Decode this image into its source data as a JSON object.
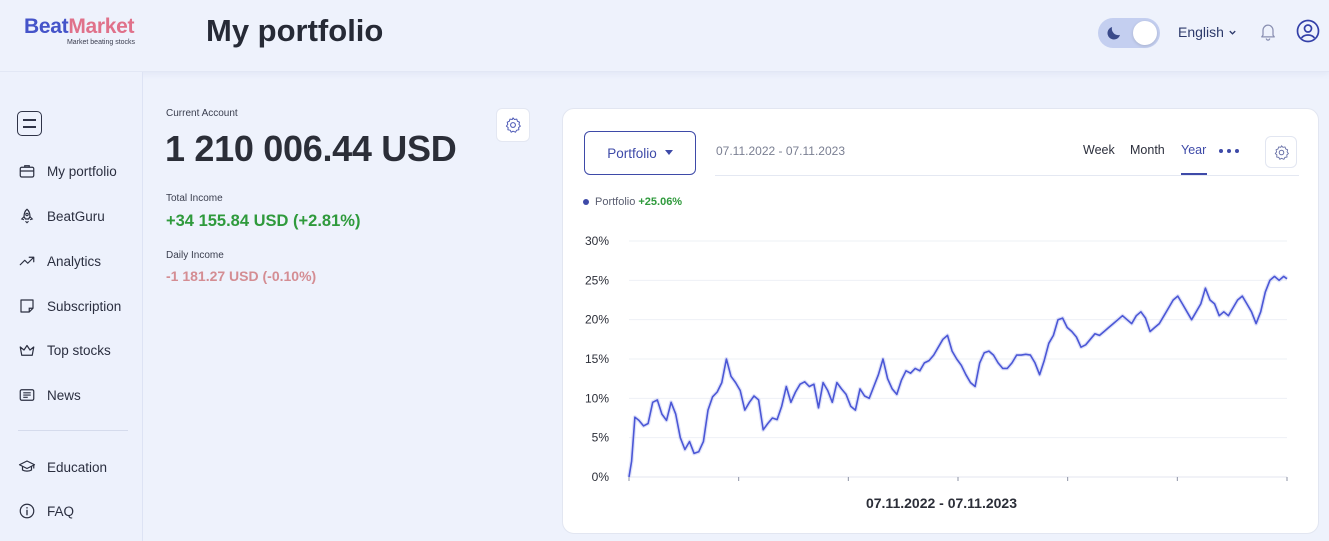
{
  "header": {
    "logo_beat": "Beat",
    "logo_market": "Market",
    "logo_tagline": "Market beating stocks",
    "title": "My portfolio",
    "language": "English"
  },
  "sidebar": {
    "items": [
      {
        "label": "My portfolio",
        "icon": "briefcase-icon"
      },
      {
        "label": "BeatGuru",
        "icon": "rocket-icon"
      },
      {
        "label": "Analytics",
        "icon": "trend-up-icon"
      },
      {
        "label": "Subscription",
        "icon": "sticky-note-icon"
      },
      {
        "label": "Top stocks",
        "icon": "crown-icon"
      },
      {
        "label": "News",
        "icon": "newspaper-icon"
      },
      {
        "label": "Education",
        "icon": "graduation-cap-icon"
      },
      {
        "label": "FAQ",
        "icon": "info-icon"
      }
    ]
  },
  "account": {
    "current_label": "Current Account",
    "current_value": "1 210 006.44 USD",
    "total_income_label": "Total Income",
    "total_income_value": "+34 155.84 USD (+2.81%)",
    "daily_income_label": "Daily Income",
    "daily_income_value": "-1 181.27 USD (-0.10%)"
  },
  "chart_panel": {
    "selector_label": "Portfolio",
    "date_range": "07.11.2022 - 07.11.2023",
    "periods": [
      "Week",
      "Month",
      "Year"
    ],
    "active_period": "Year",
    "legend_label": "Portfolio",
    "legend_value": "+25.06%"
  },
  "colors": {
    "accent": "#3e4aa8",
    "line": "#4b57d6",
    "positive": "#2f9a3c",
    "negative": "#d48d93"
  },
  "chart_data": {
    "type": "line",
    "xlabel": "07.11.2022 - 07.11.2023",
    "ylabel": "",
    "ylim": [
      0,
      30
    ],
    "yticks": [
      "0%",
      "5%",
      "10%",
      "15%",
      "20%",
      "25%",
      "30%"
    ],
    "grid": true,
    "legend": "top-left",
    "series": [
      {
        "name": "Portfolio",
        "x": [
          0,
          0.004,
          0.009,
          0.015,
          0.022,
          0.029,
          0.036,
          0.043,
          0.05,
          0.057,
          0.064,
          0.071,
          0.078,
          0.085,
          0.092,
          0.099,
          0.106,
          0.113,
          0.12,
          0.127,
          0.134,
          0.141,
          0.148,
          0.155,
          0.162,
          0.169,
          0.176,
          0.183,
          0.19,
          0.197,
          0.204,
          0.211,
          0.218,
          0.225,
          0.232,
          0.239,
          0.246,
          0.253,
          0.26,
          0.267,
          0.274,
          0.281,
          0.288,
          0.295,
          0.302,
          0.309,
          0.316,
          0.323,
          0.33,
          0.337,
          0.344,
          0.351,
          0.358,
          0.365,
          0.372,
          0.379,
          0.386,
          0.393,
          0.4,
          0.407,
          0.414,
          0.421,
          0.428,
          0.435,
          0.442,
          0.449,
          0.456,
          0.463,
          0.47,
          0.477,
          0.484,
          0.491,
          0.498,
          0.505,
          0.512,
          0.519,
          0.526,
          0.533,
          0.54,
          0.547,
          0.554,
          0.561,
          0.568,
          0.575,
          0.582,
          0.589,
          0.596,
          0.603,
          0.61,
          0.617,
          0.624,
          0.631,
          0.638,
          0.645,
          0.652,
          0.659,
          0.666,
          0.673,
          0.68,
          0.687,
          0.694,
          0.701,
          0.708,
          0.715,
          0.722,
          0.729,
          0.736,
          0.743,
          0.75,
          0.757,
          0.764,
          0.771,
          0.778,
          0.785,
          0.792,
          0.799,
          0.806,
          0.813,
          0.82,
          0.827,
          0.834,
          0.841,
          0.848,
          0.855,
          0.862,
          0.869,
          0.876,
          0.883,
          0.89,
          0.897,
          0.904,
          0.911,
          0.918,
          0.925,
          0.932,
          0.939,
          0.946,
          0.953,
          0.96,
          0.967,
          0.974,
          0.981,
          0.988,
          0.995,
          1.0
        ],
        "values": [
          0,
          2,
          7.6,
          7.2,
          6.5,
          6.8,
          9.5,
          9.8,
          8.0,
          7.2,
          9.5,
          8.0,
          5.0,
          3.5,
          4.5,
          3.0,
          3.2,
          4.5,
          8.5,
          10.2,
          10.8,
          12.0,
          15.0,
          12.8,
          12.0,
          11.0,
          8.5,
          9.5,
          10.3,
          9.8,
          6.0,
          6.8,
          7.5,
          7.3,
          9.0,
          11.5,
          9.5,
          10.8,
          11.8,
          12.1,
          11.5,
          11.8,
          8.8,
          12.0,
          11.0,
          9.5,
          12.0,
          11.2,
          10.5,
          9.0,
          8.5,
          11.2,
          10.3,
          10.0,
          11.5,
          13.0,
          15.0,
          12.5,
          11.2,
          10.5,
          12.3,
          13.5,
          13.2,
          13.8,
          13.5,
          14.5,
          14.8,
          15.5,
          16.5,
          17.5,
          18.0,
          16.0,
          15.0,
          14.2,
          13.0,
          12.0,
          11.5,
          14.5,
          15.8,
          16.0,
          15.5,
          14.5,
          13.8,
          13.8,
          14.5,
          15.5,
          15.5,
          15.6,
          15.5,
          14.5,
          13.0,
          14.8,
          17.0,
          18.0,
          20.0,
          20.2,
          19.0,
          18.5,
          17.8,
          16.5,
          16.8,
          17.5,
          18.2,
          18.0,
          18.5,
          19.0,
          19.5,
          20.0,
          20.5,
          20.0,
          19.5,
          20.5,
          21.0,
          20.2,
          18.5,
          19.0,
          19.5,
          20.5,
          21.5,
          22.5,
          23.0,
          22.0,
          21.0,
          20.0,
          21.0,
          22.0,
          24.0,
          22.5,
          22.0,
          20.5,
          21.0,
          20.5,
          21.5,
          22.5,
          23.0,
          22.0,
          21.0,
          19.5,
          21.0,
          23.5,
          25.0,
          25.5,
          25.0,
          25.5,
          25.2
        ]
      }
    ]
  }
}
